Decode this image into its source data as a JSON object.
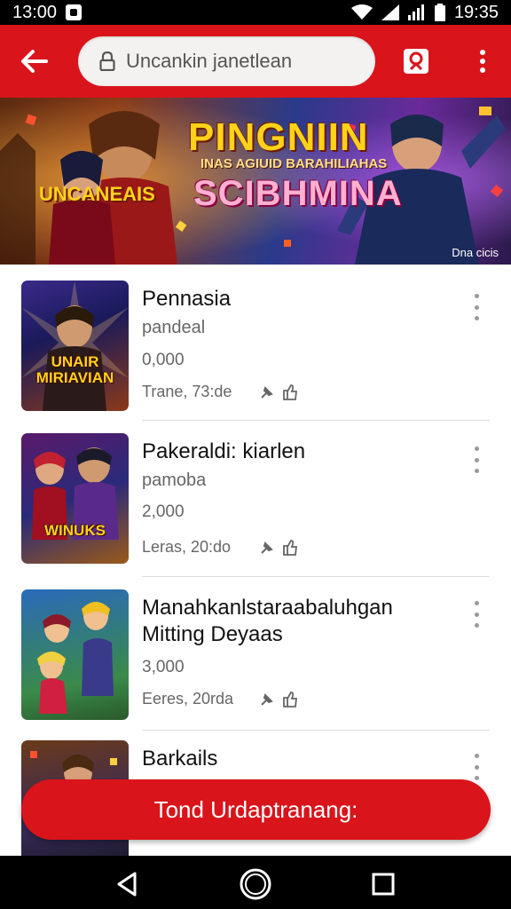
{
  "status_bar": {
    "time_left": "13:00",
    "time_right": "19:35"
  },
  "search": {
    "placeholder": "Uncankin janetlean"
  },
  "banner": {
    "title": "PINGNIIN",
    "small_text": "INAS AGIUID BARAHILIAHAS",
    "subtitle": "SCIBHMINA",
    "logo_text": "UNCANEAIS",
    "corner_text": "Dna cicis"
  },
  "items": [
    {
      "title": "Pennasia",
      "subtitle": "pandeal",
      "count": "0,000",
      "time": "Trane, 73:de",
      "thumb_label": "UNAIR MIRIAVIAN"
    },
    {
      "title": "Pakeraldi: kiarlen",
      "subtitle": "pamoba",
      "count": "2,000",
      "time": "Leras, 20:do",
      "thumb_label": "WINUKS"
    },
    {
      "title": "Manahkanlstaraabaluhgan Mitting Deyaas",
      "subtitle": "",
      "count": "3,000",
      "time": "Eeres, 20rda",
      "thumb_label": ""
    },
    {
      "title": "Barkails",
      "subtitle": "",
      "count": "",
      "time": "",
      "thumb_label": ""
    }
  ],
  "cta": {
    "label": "Tond Urdaptranang:"
  },
  "colors": {
    "brand_red": "#d9141b"
  },
  "icons": [
    "back-arrow-icon",
    "lock-icon",
    "bookmark-icon",
    "more-vert-icon",
    "wifi-icon",
    "signal-icon",
    "battery-icon",
    "pin-icon",
    "share-icon"
  ]
}
